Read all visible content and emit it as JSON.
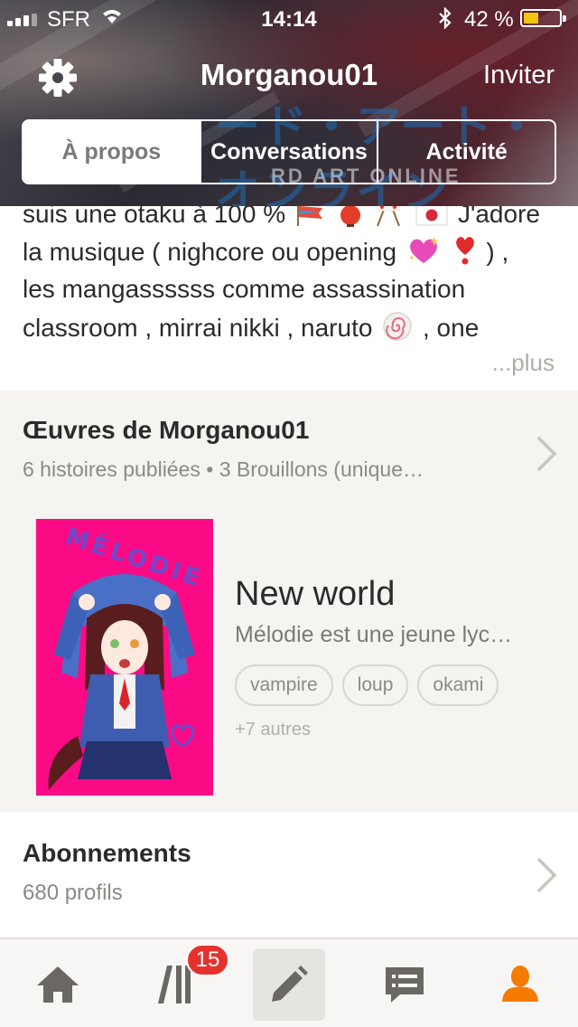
{
  "status_bar": {
    "carrier": "SFR",
    "time": "14:14",
    "battery_percent": "42 %",
    "battery_level": 0.42
  },
  "header": {
    "username": "Morganou01",
    "invite_label": "Inviter",
    "background_text_jp": "ード・アート・オンライン",
    "background_text_en": "RD ART ONLINE"
  },
  "tabs": [
    {
      "label": "À propos",
      "active": true
    },
    {
      "label": "Conversations",
      "active": false
    },
    {
      "label": "Activité",
      "active": false
    }
  ],
  "about": {
    "lines": [
      "suis une otaku à 100 %",
      "J'adore",
      "la musique ( nighcore ou opening",
      ") ,",
      "les mangassssss comme assassination",
      "classroom , mirrai nikki , naruto",
      ", one"
    ],
    "more_label": "...plus"
  },
  "works": {
    "title": "Œuvres de Morganou01",
    "subtitle": "6 histoires publiées • 3 Brouillons (unique…",
    "story": {
      "title": "New world",
      "description": "Mélodie est une jeune lyc…",
      "cover_text": "MÉLODIE",
      "tags": [
        "vampire",
        "loup",
        "okami"
      ],
      "more_tags": "+7 autres"
    }
  },
  "follows": {
    "title": "Abonnements",
    "subtitle": "680 profils"
  },
  "tabbar": {
    "notification_count": "15",
    "items": [
      "home-icon",
      "library-icon",
      "write-icon",
      "messages-icon",
      "profile-icon"
    ]
  },
  "colors": {
    "accent": "#f57c00",
    "badge": "#e5322e",
    "cover_pink": "#fb0a86",
    "section_bg": "#f5f4f1"
  }
}
